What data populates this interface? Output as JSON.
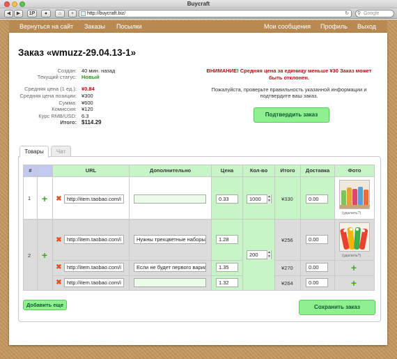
{
  "browser": {
    "window_title": "Buycraft",
    "url": "http://buycraft.biz/",
    "search_placeholder": "Google"
  },
  "nav": {
    "left": [
      "Вернуться на сайт",
      "Заказы",
      "Посылки"
    ],
    "right": [
      "Мои сообщения",
      "Профиль",
      "Выход"
    ]
  },
  "order": {
    "title": "Заказ «wmuzz-29.04.13-1»",
    "info": [
      {
        "label": "Создан:",
        "value": "40 мин. назад"
      },
      {
        "label": "Текущий статус:",
        "value": "Новый"
      },
      {
        "label": "Средняя цена (1 ед.):",
        "value": "¥0.84"
      },
      {
        "label": "Средняя цена позиции:",
        "value": "¥300"
      },
      {
        "label": "Сумма:",
        "value": "¥600"
      },
      {
        "label": "Комиссия:",
        "value": "¥120"
      },
      {
        "label": "Курс RMB/USD:",
        "value": "6.3"
      },
      {
        "label": "Итого:",
        "value": "$114.29"
      }
    ]
  },
  "alert": {
    "warning": "ВНИМАНИЕ! Средняя цена за единицу меньше ¥30 Заказ может быть отклонен.",
    "note": "Пожалуйста, проверьте правильность указанной информации и подтвердите ваш заказ.",
    "confirm_button": "Подтвердить заказ"
  },
  "tabs": [
    "Товары",
    "Чат"
  ],
  "table": {
    "headers": [
      "#",
      "",
      "URL",
      "Дополнительно",
      "Цена",
      "Кол-во",
      "Итого",
      "Доставка",
      "Фото"
    ],
    "row1": {
      "num": "1",
      "url": "http://item.taobao.com/i",
      "extra": "",
      "price": "0.33",
      "qty": "1000",
      "total": "¥330",
      "delivery": "0.00",
      "remove_photo": "(удалить?)"
    },
    "row2": {
      "num": "2",
      "qty": "200",
      "remove_photo": "(удалить?)",
      "items": [
        {
          "url": "http://item.taobao.com/i",
          "extra": "Нужны трехцветные наборы",
          "price": "1.28",
          "total": "¥256",
          "delivery": "0.00"
        },
        {
          "url": "http://item.taobao.com/i",
          "extra": "Если не будет первого вариа",
          "price": "1.35",
          "total": "¥270",
          "delivery": "0.00"
        },
        {
          "url": "http://item.taobao.com/i",
          "extra": "",
          "price": "1.32",
          "total": "¥264",
          "delivery": "0.00"
        }
      ]
    }
  },
  "buttons": {
    "add_more": "Добавить еще",
    "save_order": "Сохранить заказ"
  }
}
